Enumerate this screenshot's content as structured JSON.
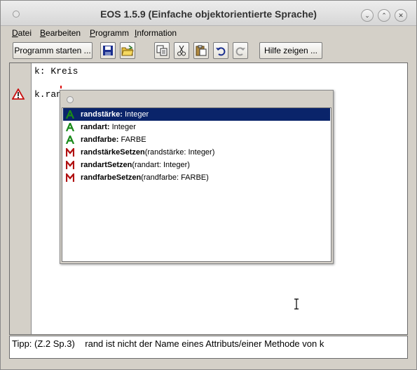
{
  "window": {
    "title": "EOS 1.5.9 (Einfache objektorientierte Sprache)"
  },
  "menu": [
    {
      "label": "Datei",
      "u": "D",
      "rest": "atei"
    },
    {
      "label": "Bearbeiten",
      "u": "B",
      "rest": "earbeiten"
    },
    {
      "label": "Programm",
      "u": "P",
      "rest": "rogramm"
    },
    {
      "label": "Information",
      "u": "I",
      "rest": "nformation"
    }
  ],
  "toolbar": {
    "start_label": "Programm starten ...",
    "help_label": "Hilfe zeigen ...",
    "icons": [
      "save-icon",
      "open-folder-icon",
      "copy-icon",
      "cut-icon",
      "paste-icon",
      "undo-icon",
      "redo-icon"
    ]
  },
  "editor": {
    "lines": [
      "k: Kreis",
      "",
      "k.ran"
    ]
  },
  "autocomplete": {
    "items": [
      {
        "kind": "A",
        "name": "randstärke:",
        "detail": " Integer",
        "selected": true
      },
      {
        "kind": "A",
        "name": "randart:",
        "detail": " Integer",
        "selected": false
      },
      {
        "kind": "A",
        "name": "randfarbe:",
        "detail": " FARBE",
        "selected": false
      },
      {
        "kind": "M",
        "name": "randstärkeSetzen",
        "detail": "(randstärke: Integer)",
        "selected": false
      },
      {
        "kind": "M",
        "name": "randartSetzen",
        "detail": "(randart: Integer)",
        "selected": false
      },
      {
        "kind": "M",
        "name": "randfarbeSetzen",
        "detail": "(randfarbe: FARBE)",
        "selected": false
      }
    ]
  },
  "status": {
    "text": "Tipp: (Z.2 Sp.3)    rand ist nicht der Name eines Attributs/einer Methode von k"
  },
  "colors": {
    "attribute": "#1a8a1a",
    "method": "#b01010",
    "selection": "#0a246a"
  }
}
